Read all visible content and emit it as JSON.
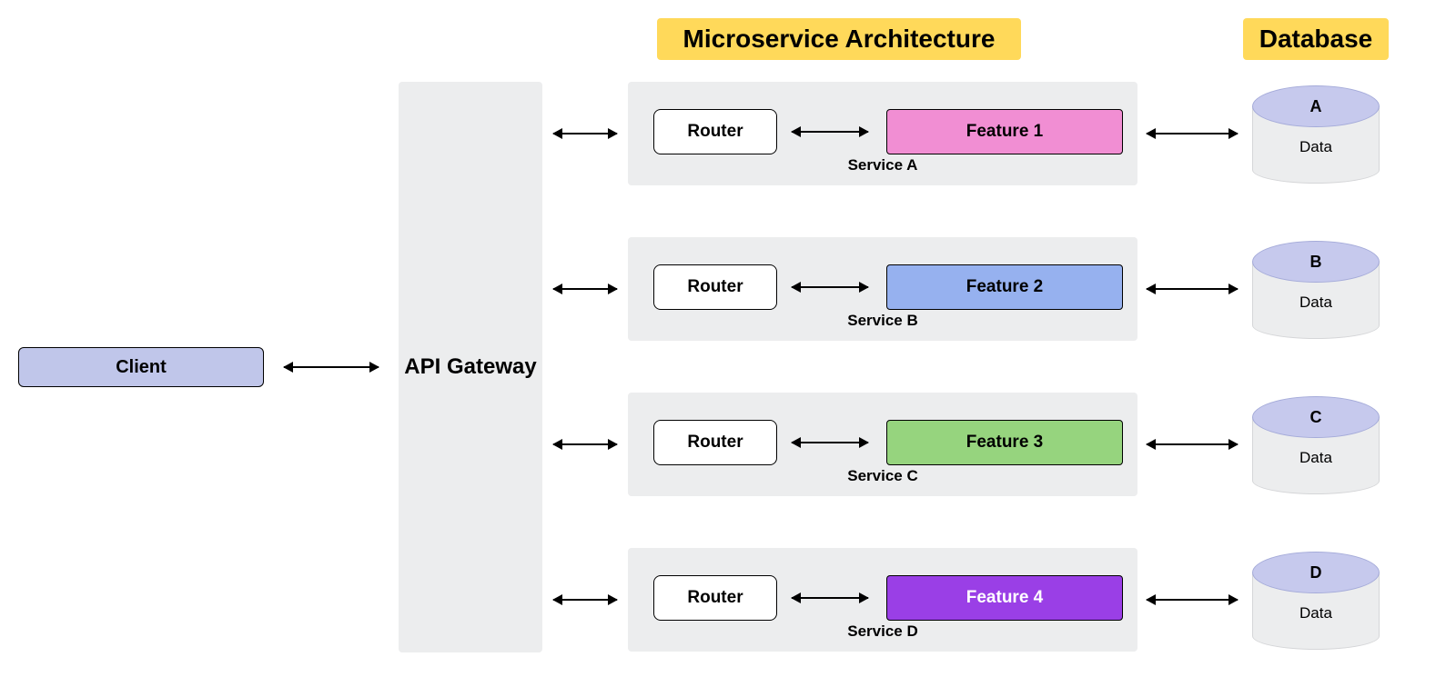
{
  "headers": {
    "microservice": "Microservice Architecture",
    "database": "Database"
  },
  "client": {
    "label": "Client"
  },
  "gateway": {
    "label": "API Gateway"
  },
  "services": [
    {
      "id": "A",
      "router": "Router",
      "feature": "Feature 1",
      "label": "Service A",
      "color": "#f18ed3"
    },
    {
      "id": "B",
      "router": "Router",
      "feature": "Feature 2",
      "label": "Service B",
      "color": "#96b1ef"
    },
    {
      "id": "C",
      "router": "Router",
      "feature": "Feature 3",
      "label": "Service C",
      "color": "#96d47e"
    },
    {
      "id": "D",
      "router": "Router",
      "feature": "Feature 4",
      "label": "Service D",
      "color": "#9a3fe6",
      "text": "#ffffff"
    }
  ],
  "databases": [
    {
      "letter": "A",
      "label": "Data"
    },
    {
      "letter": "B",
      "label": "Data"
    },
    {
      "letter": "C",
      "label": "Data"
    },
    {
      "letter": "D",
      "label": "Data"
    }
  ]
}
